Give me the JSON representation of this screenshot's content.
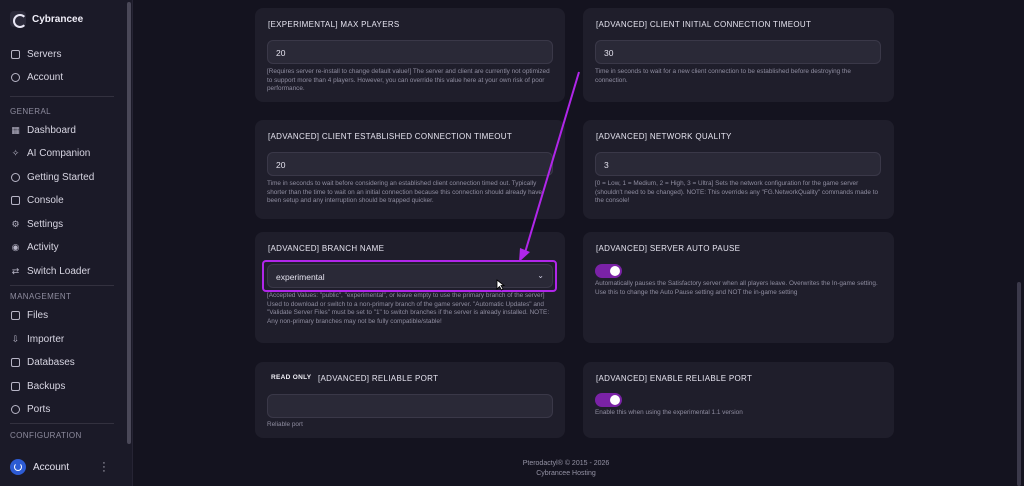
{
  "brand": {
    "name": "Cybrancee"
  },
  "sidebar": {
    "top_items": [
      {
        "label": "Servers",
        "icon": "servers-icon"
      },
      {
        "label": "Account",
        "icon": "account-icon"
      }
    ],
    "general_label": "GENERAL",
    "general_items": [
      {
        "label": "Dashboard",
        "icon": "dashboard-icon"
      },
      {
        "label": "AI Companion",
        "icon": "ai-companion-icon"
      },
      {
        "label": "Getting Started",
        "icon": "rocket-icon"
      },
      {
        "label": "Console",
        "icon": "console-icon"
      },
      {
        "label": "Settings",
        "icon": "settings-icon"
      },
      {
        "label": "Activity",
        "icon": "activity-icon"
      },
      {
        "label": "Switch Loader",
        "icon": "switch-icon"
      }
    ],
    "management_label": "MANAGEMENT",
    "management_items": [
      {
        "label": "Files",
        "icon": "files-icon"
      },
      {
        "label": "Importer",
        "icon": "importer-icon"
      },
      {
        "label": "Databases",
        "icon": "databases-icon"
      },
      {
        "label": "Backups",
        "icon": "backups-icon"
      },
      {
        "label": "Ports",
        "icon": "ports-icon"
      }
    ],
    "configuration_label": "CONFIGURATION",
    "account_label": "Account"
  },
  "cards": {
    "max_players": {
      "title": "[EXPERIMENTAL] MAX PLAYERS",
      "value": "20",
      "help": "[Requires server re-install to change default value!] The server and client are currently not optimized to support more than 4 players. However, you can override this value here at your own risk of poor performance."
    },
    "client_initial_timeout": {
      "title": "[ADVANCED] CLIENT INITIAL CONNECTION TIMEOUT",
      "value": "30",
      "help": "Time in seconds to wait for a new client connection to be established before destroying the connection."
    },
    "client_established_timeout": {
      "title": "[ADVANCED] CLIENT ESTABLISHED CONNECTION TIMEOUT",
      "value": "20",
      "help": "Time in seconds to wait before considering an established client connection timed out. Typically shorter than the time to wait on an initial connection because this connection should already have been setup and any interruption should be trapped quicker."
    },
    "network_quality": {
      "title": "[ADVANCED] NETWORK QUALITY",
      "value": "3",
      "help": "[0 = Low, 1 = Medium, 2 = High, 3 = Ultra] Sets the network configuration for the game server (shouldn't need to be changed). NOTE: This overrides any \"FG.NetworkQuality\" commands made to the console!"
    },
    "branch_name": {
      "title": "[ADVANCED] BRANCH NAME",
      "value": "experimental",
      "help": "[Accepted Values: \"public\", \"experimental\", or leave empty to use the primary branch of the server] Used to download or switch to a non-primary branch of the game server. \"Automatic Updates\" and \"Validate Server Files\" must be set to \"1\" to switch branches if the server is already installed. NOTE: Any non-primary branches may not be fully compatible/stable!"
    },
    "server_auto_pause": {
      "title": "[ADVANCED] SERVER AUTO PAUSE",
      "enabled": true,
      "help": "Automatically pauses the Satisfactory server when all players leave. Overwrites the In-game setting. Use this to change the Auto Pause setting and NOT the in-game setting"
    },
    "reliable_port": {
      "badge": "READ ONLY",
      "title": "[ADVANCED] RELIABLE PORT",
      "value": "",
      "help": "Reliable port"
    },
    "enable_reliable_port": {
      "title": "[ADVANCED] ENABLE RELIABLE PORT",
      "enabled": true,
      "help": "Enable this when using the experimental 1.1 version"
    }
  },
  "footer": {
    "line1": "Pterodactyl® © 2015 - 2026",
    "line2": "Cybrancee Hosting"
  },
  "colors": {
    "accent": "#b026e9",
    "toggle_on": "#7a22a6",
    "card_bg": "#1f1e2b",
    "page_bg": "#14131f"
  }
}
